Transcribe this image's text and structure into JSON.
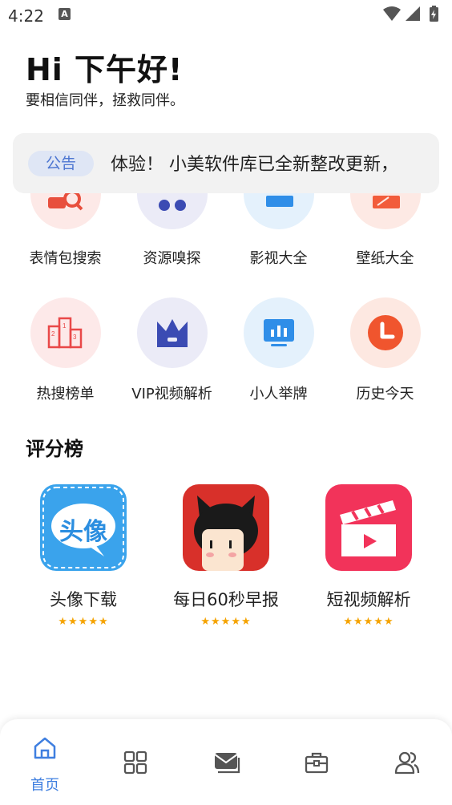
{
  "status_bar": {
    "time": "4:22",
    "notification_icon": "A"
  },
  "greeting": {
    "title": "Hi 下午好!",
    "subtitle": "要相信同伴，拯救同伴。"
  },
  "notice": {
    "tag": "公告",
    "text": "体验！  小美软件库已全新整改更新，"
  },
  "tools_row_1": [
    {
      "label": "表情包搜索",
      "icon": "search-icon",
      "color": "#e84f3d",
      "bg": "#fde9e7"
    },
    {
      "label": "资源嗅探",
      "icon": "sniff-icon",
      "color": "#3b4bb3",
      "bg": "#ebebf7"
    },
    {
      "label": "影视大全",
      "icon": "film-icon",
      "color": "#2f8ee8",
      "bg": "#e4f1fc"
    },
    {
      "label": "壁纸大全",
      "icon": "wallpaper-icon",
      "color": "#f25c3b",
      "bg": "#fde9e4"
    }
  ],
  "tools_row_2": [
    {
      "label": "热搜榜单",
      "icon": "podium-icon",
      "color": "#e94848",
      "bg": "#fde9e9"
    },
    {
      "label": "VIP视频解析",
      "icon": "crown-icon",
      "color": "#3b4bb3",
      "bg": "#ebebf7"
    },
    {
      "label": "小人举牌",
      "icon": "board-icon",
      "color": "#2f8ee8",
      "bg": "#e4f1fc"
    },
    {
      "label": "历史今天",
      "icon": "clock-icon",
      "color": "#f0552e",
      "bg": "#fde8e1"
    }
  ],
  "ranking": {
    "title": "评分榜",
    "apps": [
      {
        "name": "头像下载",
        "icon": "avatar-app-icon",
        "stars": "★★★★★"
      },
      {
        "name": "每日60秒早报",
        "icon": "cartoon-cat-app-icon",
        "stars": "★★★★★"
      },
      {
        "name": "短视频解析",
        "icon": "clapper-app-icon",
        "stars": "★★★★★"
      }
    ],
    "avatar_icon_text": "头像"
  },
  "bottom_nav": {
    "active_label": "首页",
    "items": [
      "home-icon",
      "apps-grid-icon",
      "mail-icon",
      "toolbox-icon",
      "users-icon"
    ],
    "active_color": "#3f7fe0",
    "inactive_color": "#555555"
  }
}
